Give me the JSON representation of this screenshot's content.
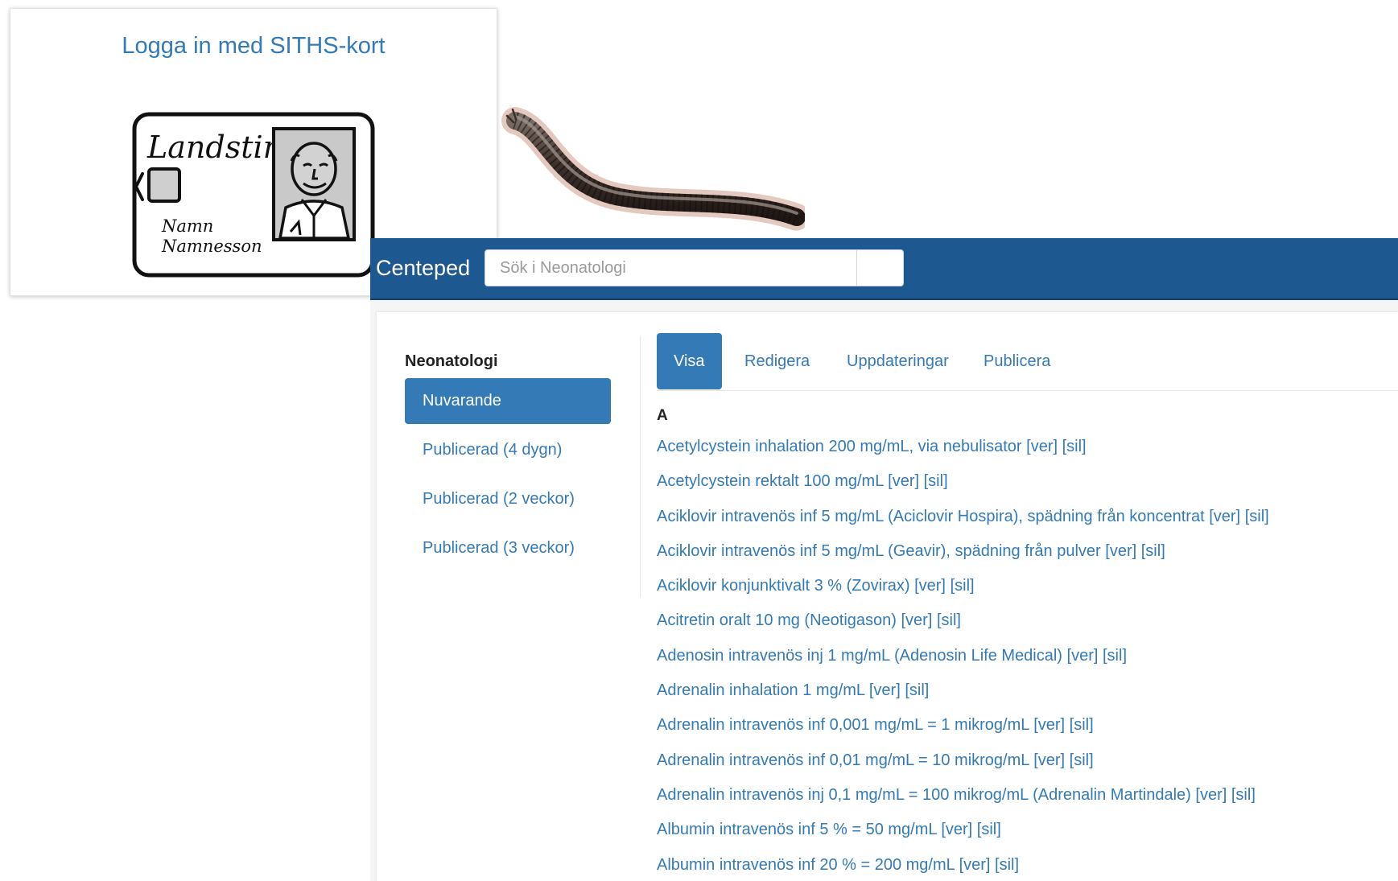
{
  "login": {
    "title": "Logga in med SITHS-kort",
    "card": {
      "brand": "Landsting",
      "name_line1": "Namn",
      "name_line2": "Namnesson"
    }
  },
  "illustration": {
    "icon": "millipede"
  },
  "app": {
    "brand": "Centeped",
    "search": {
      "placeholder": "Sök i Neonatologi",
      "value": ""
    },
    "colors": {
      "navbar": "#1e5890",
      "accent": "#337ab7"
    },
    "sidebar": {
      "heading": "Neonatologi",
      "items": [
        {
          "label": "Nuvarande",
          "active": true
        },
        {
          "label": "Publicerad (4 dygn)",
          "active": false
        },
        {
          "label": "Publicerad (2 veckor)",
          "active": false
        },
        {
          "label": "Publicerad (3 veckor)",
          "active": false
        }
      ]
    },
    "tabs": [
      {
        "label": "Visa",
        "active": true
      },
      {
        "label": "Redigera",
        "active": false
      },
      {
        "label": "Uppdateringar",
        "active": false
      },
      {
        "label": "Publicera",
        "active": false
      }
    ],
    "section_letter": "A",
    "drugs": [
      {
        "name": "Acetylcystein inhalation 200 mg/mL, via nebulisator",
        "ver": "[ver]",
        "sil": "[sil]"
      },
      {
        "name": "Acetylcystein rektalt 100 mg/mL",
        "ver": "[ver]",
        "sil": "[sil]"
      },
      {
        "name": "Aciklovir intravenös inf 5 mg/mL (Aciclovir Hospira), spädning från koncentrat",
        "ver": "[ver]",
        "sil": "[sil]"
      },
      {
        "name": "Aciklovir intravenös inf 5 mg/mL (Geavir), spädning från pulver",
        "ver": "[ver]",
        "sil": "[sil]"
      },
      {
        "name": "Aciklovir konjunktivalt 3 % (Zovirax)",
        "ver": "[ver]",
        "sil": "[sil]"
      },
      {
        "name": "Acitretin oralt 10 mg (Neotigason)",
        "ver": "[ver]",
        "sil": "[sil]"
      },
      {
        "name": "Adenosin intravenös inj 1 mg/mL (Adenosin Life Medical)",
        "ver": "[ver]",
        "sil": "[sil]"
      },
      {
        "name": "Adrenalin inhalation 1 mg/mL",
        "ver": "[ver]",
        "sil": "[sil]"
      },
      {
        "name": "Adrenalin intravenös inf 0,001 mg/mL = 1 mikrog/mL",
        "ver": "[ver]",
        "sil": "[sil]"
      },
      {
        "name": "Adrenalin intravenös inf 0,01 mg/mL = 10 mikrog/mL",
        "ver": "[ver]",
        "sil": "[sil]"
      },
      {
        "name": "Adrenalin intravenös inj 0,1 mg/mL = 100 mikrog/mL (Adrenalin Martindale)",
        "ver": "[ver]",
        "sil": "[sil]"
      },
      {
        "name": "Albumin intravenös inf 5 % = 50 mg/mL",
        "ver": "[ver]",
        "sil": "[sil]"
      },
      {
        "name": "Albumin intravenös inf 20 % = 200 mg/mL",
        "ver": "[ver]",
        "sil": "[sil]"
      }
    ]
  }
}
